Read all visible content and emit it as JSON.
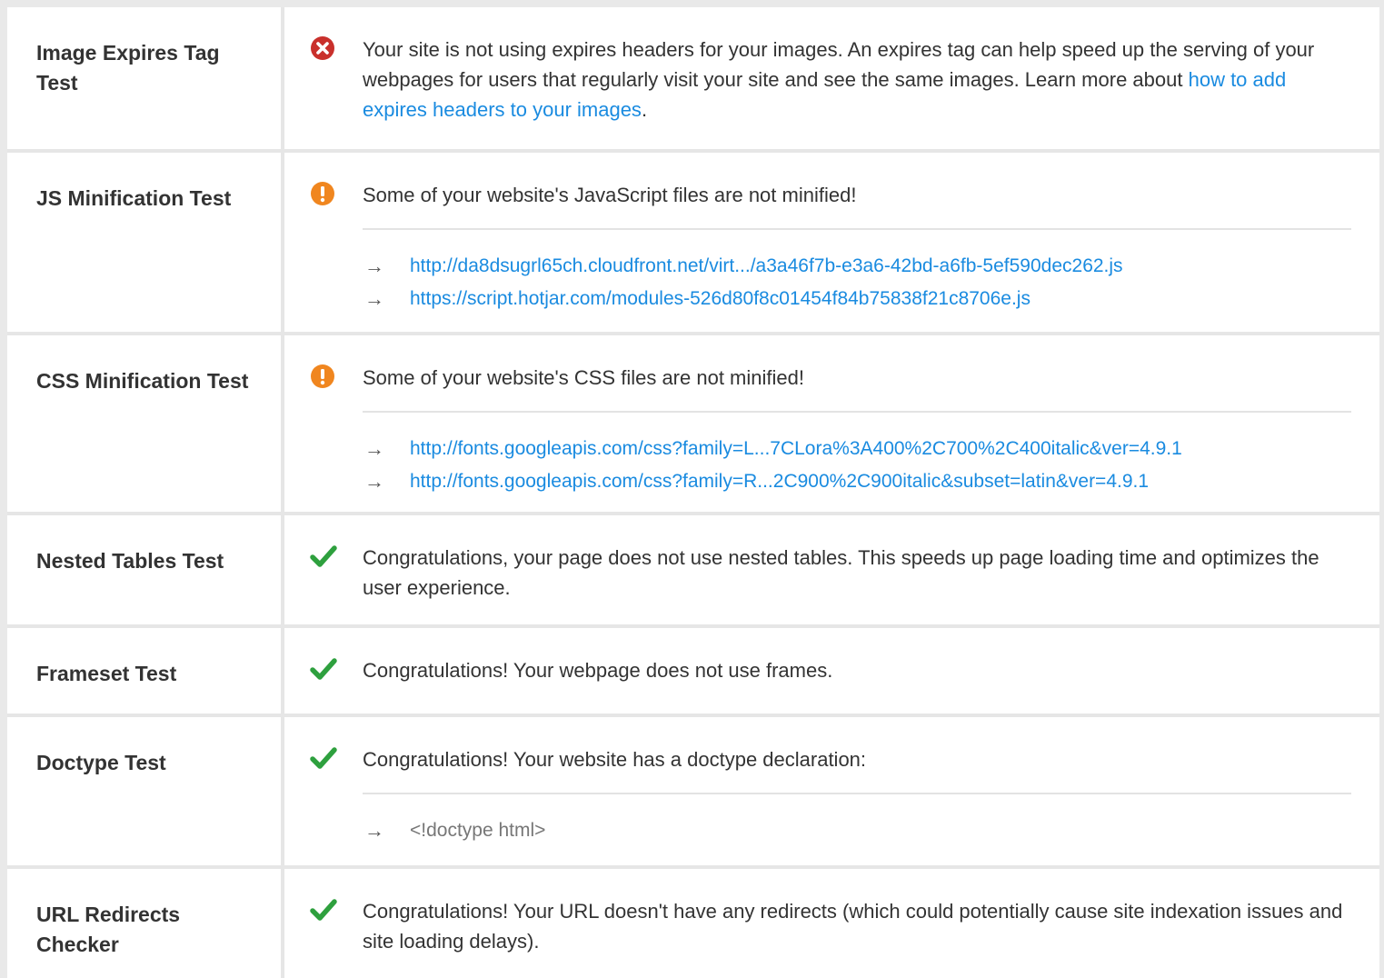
{
  "colors": {
    "error": "#c9302c",
    "warning": "#f0861f",
    "success": "#2ea03e",
    "link": "#1a8be0"
  },
  "tests": [
    {
      "name": "Image Expires Tag Test",
      "status": "error",
      "icon": "error-x-icon",
      "message_pre": "Your site is not using expires headers for your images. An expires tag can help speed up the serving of your webpages for users that regularly visit your site and see the same images. Learn more about ",
      "message_link": "how to add expires headers to your images",
      "message_post": "."
    },
    {
      "name": "JS Minification Test",
      "status": "warning",
      "icon": "warning-exclamation-icon",
      "message": "Some of your website's JavaScript files are not minified!",
      "links": [
        "http://da8dsugrl65ch.cloudfront.net/virt.../a3a46f7b-e3a6-42bd-a6fb-5ef590dec262.js",
        "https://script.hotjar.com/modules-526d80f8c01454f84b75838f21c8706e.js"
      ]
    },
    {
      "name": "CSS Minification Test",
      "status": "warning",
      "icon": "warning-exclamation-icon",
      "message": "Some of your website's CSS files are not minified!",
      "links": [
        "http://fonts.googleapis.com/css?family=L...7CLora%3A400%2C700%2C400italic&ver=4.9.1",
        "http://fonts.googleapis.com/css?family=R...2C900%2C900italic&subset=latin&ver=4.9.1"
      ]
    },
    {
      "name": "Nested Tables Test",
      "status": "success",
      "icon": "checkmark-icon",
      "message": "Congratulations, your page does not use nested tables. This speeds up page loading time and optimizes the user experience."
    },
    {
      "name": "Frameset Test",
      "status": "success",
      "icon": "checkmark-icon",
      "message": "Congratulations! Your webpage does not use frames."
    },
    {
      "name": "Doctype Test",
      "status": "success",
      "icon": "checkmark-icon",
      "message": "Congratulations! Your website has a doctype declaration:",
      "value": "<!doctype html>"
    },
    {
      "name": "URL Redirects Checker",
      "status": "success",
      "icon": "checkmark-icon",
      "message": "Congratulations! Your URL doesn't have any redirects (which could potentially cause site indexation issues and site loading delays)."
    }
  ]
}
